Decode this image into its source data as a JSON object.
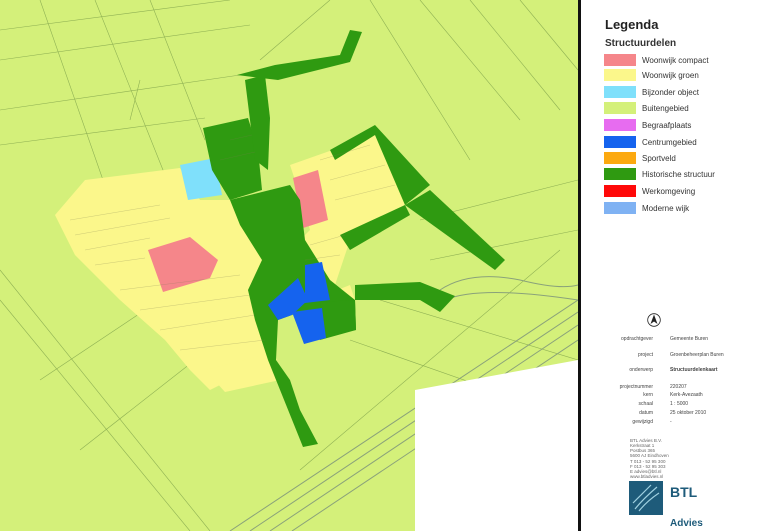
{
  "legend": {
    "title": "Legenda",
    "subtitle": "Structuurdelen",
    "items": [
      {
        "label": "Woonwijk compact",
        "color": "#f5868a"
      },
      {
        "label": "Woonwijk groen",
        "color": "#fbf78b"
      },
      {
        "label": "Bijzonder object",
        "color": "#7fe0fb"
      },
      {
        "label": "Buitengebied",
        "color": "#d4f07a"
      },
      {
        "label": "Begraafplaats",
        "color": "#e76cf0"
      },
      {
        "label": "Centrumgebied",
        "color": "#1563ee"
      },
      {
        "label": "Sportveld",
        "color": "#fca910"
      },
      {
        "label": "Historische structuur",
        "color": "#2f9a11"
      },
      {
        "label": "Werkomgeving",
        "color": "#ff0909"
      },
      {
        "label": "Moderne wijk",
        "color": "#7fb2f3"
      }
    ]
  },
  "info": {
    "fields": [
      {
        "key": "opdrachtgever",
        "value": "Gemeente Buren"
      },
      {
        "key": "project",
        "value": "Groenbeheerplan Buren"
      },
      {
        "key": "onderwerp",
        "value": "Structuurdelenkaart"
      },
      {
        "key": "projectnummer",
        "value": "220207"
      },
      {
        "key": "kern",
        "value": "Kerk-Avezaath"
      },
      {
        "key": "schaal",
        "value": "1 : 5000"
      },
      {
        "key": "datum",
        "value": "25 oktober 2010"
      },
      {
        "key": "gewijzigd",
        "value": "-"
      }
    ],
    "address": [
      "BTL Advies B.V.",
      "Kerkstraat 1",
      "Postbus 365",
      "5600 AJ Eindhoven",
      "T 013 - 52 95 300",
      "F 013 - 52 95 303",
      "E advies@btl.nl",
      "www.btladvies.nl"
    ],
    "brand": "BTL",
    "brand_sub": "Advies"
  },
  "map": {
    "colors": {
      "background": "#d4f07a",
      "compact": "#f5868a",
      "groen": "#fbf78b",
      "bijzonder": "#7fe0fb",
      "centrum": "#1563ee",
      "historisch": "#2f9a11"
    }
  }
}
